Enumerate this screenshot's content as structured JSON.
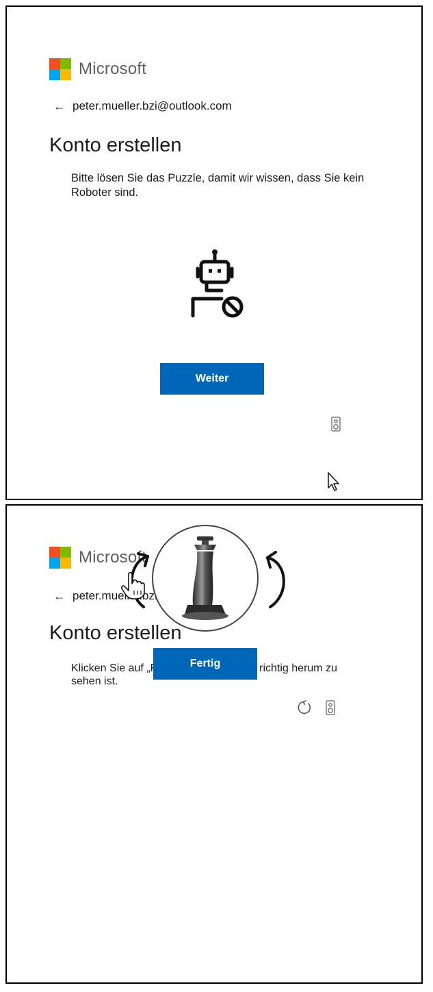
{
  "brand": {
    "name": "Microsoft",
    "colors": [
      "#f25022",
      "#7fba00",
      "#00a4ef",
      "#ffb900"
    ]
  },
  "step1": {
    "identity": "peter.mueller.bzi@outlook.com",
    "title": "Konto erstellen",
    "description": "Bitte lösen Sie das Puzzle, damit wir wissen, dass Sie kein Roboter sind.",
    "button_label": "Weiter",
    "icons": [
      "back-arrow-icon",
      "robot-blocked-icon",
      "audio-icon",
      "mouse-pointer-icon"
    ]
  },
  "step2": {
    "identity": "peter.mueller.bzi@outlook.com",
    "title": "Konto erstellen",
    "description": "Klicken Sie auf „Fertig\", wenn das Bild richtig herum zu sehen ist.",
    "button_label": "Fertig",
    "icons": [
      "back-arrow-icon",
      "rotate-left-icon",
      "rotate-right-icon",
      "reload-icon",
      "audio-icon",
      "hand-pointer-icon"
    ]
  },
  "accent_color": "#0067b8"
}
